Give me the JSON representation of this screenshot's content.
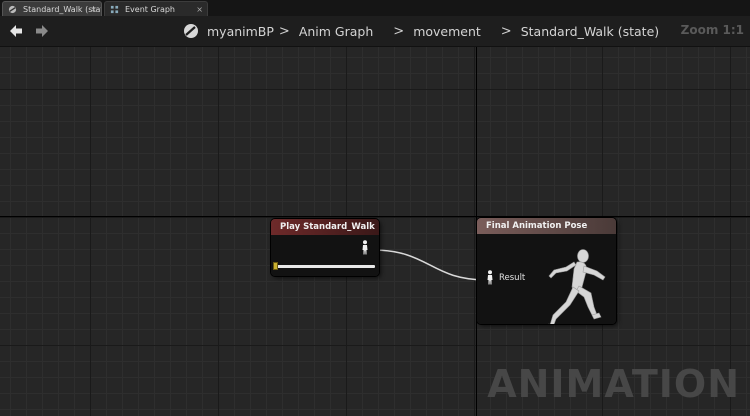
{
  "tabs": [
    {
      "label": "Standard_Walk (state"
    },
    {
      "label": "Event Graph"
    }
  ],
  "breadcrumb": {
    "items": [
      "myanimBP",
      "Anim Graph",
      "movement",
      "Standard_Walk (state)"
    ],
    "separator": ">"
  },
  "zoom": {
    "label": "Zoom 1:1"
  },
  "nodes": {
    "play": {
      "title": "Play Standard_Walk"
    },
    "final": {
      "title": "Final Animation Pose",
      "pin_label": "Result"
    }
  },
  "watermark": "ANIMATION",
  "colors": {
    "play_header": "#6e2a2a",
    "final_header": "#7a5d5a",
    "slider_handle": "#c8b030",
    "graph_background": "#262626"
  }
}
